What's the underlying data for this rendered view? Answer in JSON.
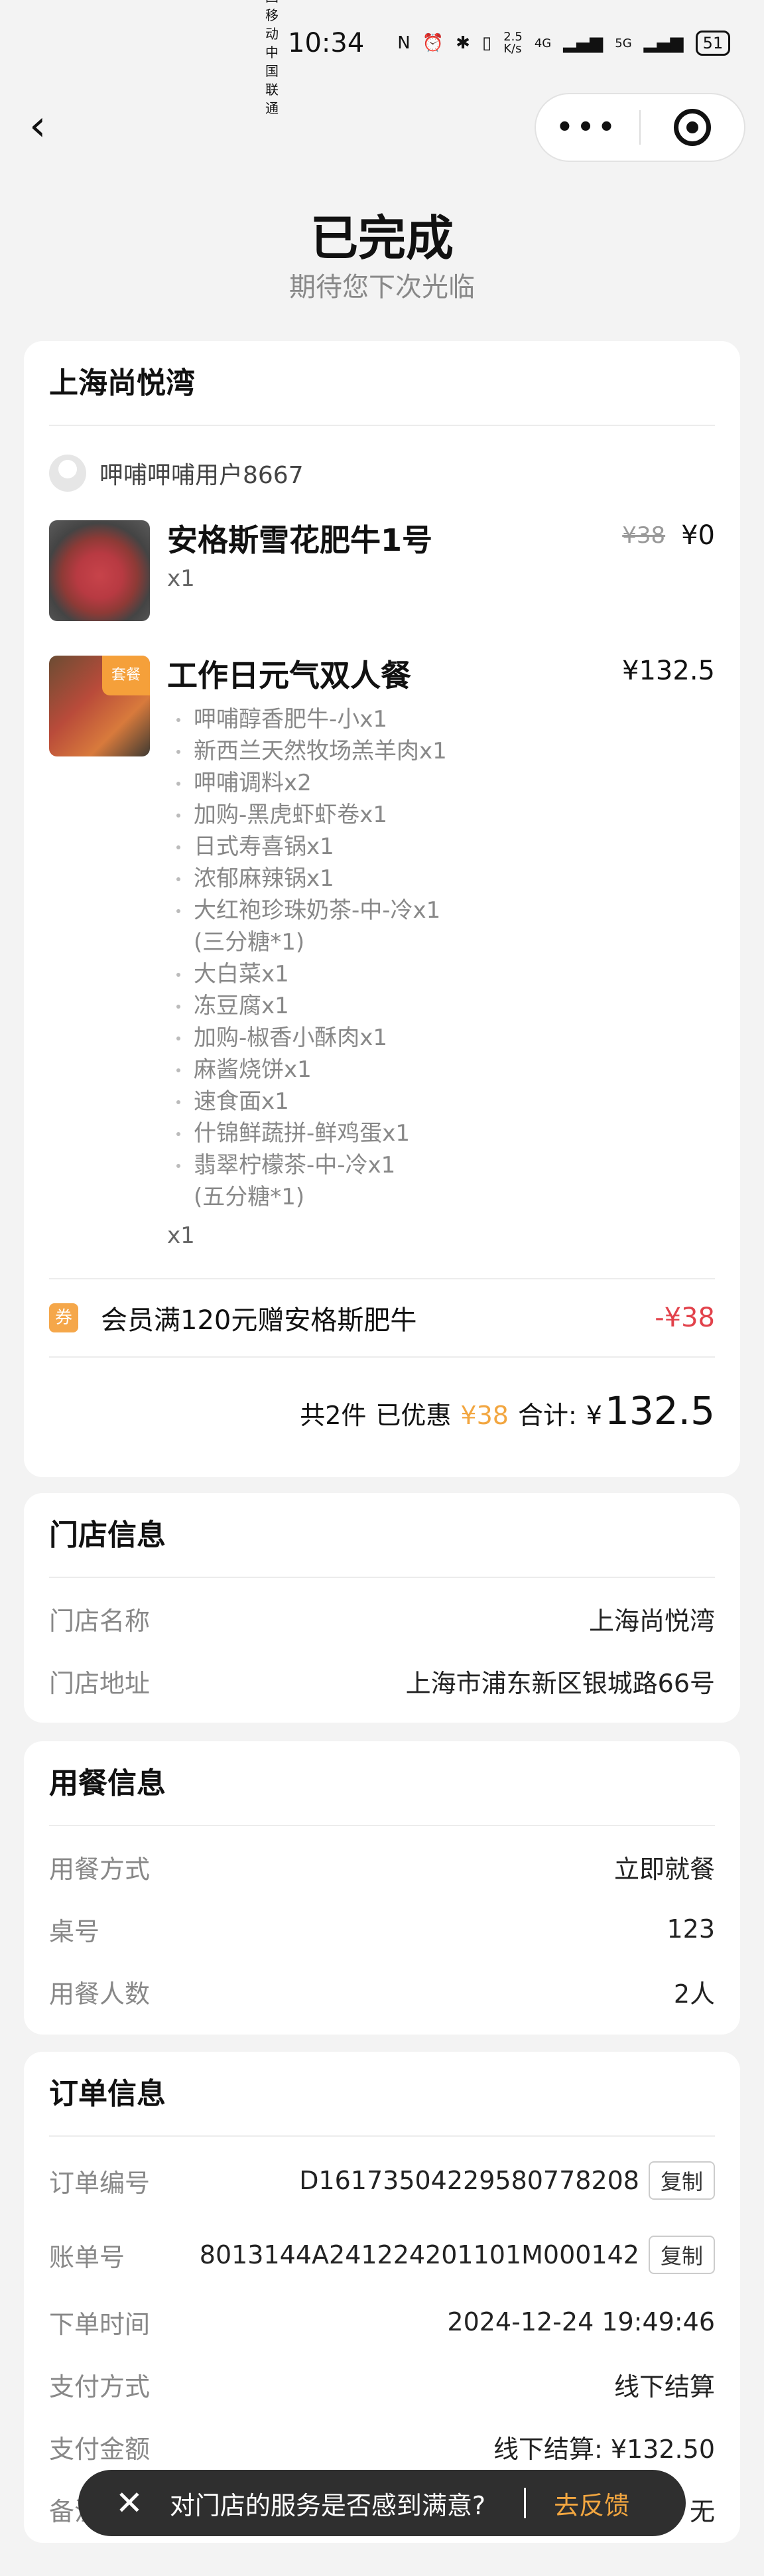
{
  "status_bar": {
    "carrier1": "中国移动",
    "carrier2": "中国联通",
    "time": "10:34",
    "icons": [
      "nfc-icon",
      "alarm-icon",
      "bluetooth-icon",
      "vibrate-icon",
      "speed",
      "signal-4g",
      "signal-5g"
    ],
    "speed": "2.5 K/s",
    "net1": "4G",
    "net2": "5G",
    "battery": "51"
  },
  "nav": {
    "back_glyph": "‹",
    "more_glyph": "•••"
  },
  "header": {
    "title": "已完成",
    "subtitle": "期待您下次光临"
  },
  "order": {
    "store": "上海尚悦湾",
    "user": "呷哺呷哺用户8667",
    "items": [
      {
        "name": "安格斯雪花肥牛1号",
        "qty": "x1",
        "orig_price": "¥38",
        "price": "¥0"
      },
      {
        "name": "工作日元气双人餐",
        "tag": "套餐",
        "price": "¥132.5",
        "sub": [
          "呷哺醇香肥牛-小x1",
          "新西兰天然牧场羔羊肉x1",
          "呷哺调料x2",
          "加购-黑虎虾虾卷x1",
          "日式寿喜锅x1",
          "浓郁麻辣锅x1",
          "大红袍珍珠奶茶-中-冷x1",
          "大白菜x1",
          "冻豆腐x1",
          "加购-椒香小酥肉x1",
          "麻酱烧饼x1",
          "速食面x1",
          "什锦鲜蔬拼-鲜鸡蛋x1",
          "翡翠柠檬茶-中-冷x1"
        ],
        "sub_note_6": "(三分糖*1)",
        "sub_note_13": "(五分糖*1)",
        "qty": "x1"
      }
    ],
    "promo": {
      "badge": "券",
      "text": "会员满120元赠安格斯肥牛",
      "amount": "-¥38"
    },
    "summary": {
      "count": "共2件",
      "discount_label": "已优惠",
      "discount": "¥38",
      "total_label": "合计:",
      "currency": "¥",
      "total": "132.5"
    }
  },
  "store_info": {
    "title": "门店信息",
    "name_label": "门店名称",
    "name": "上海尚悦湾",
    "addr_label": "门店地址",
    "addr": "上海市浦东新区银城路66号"
  },
  "dining_info": {
    "title": "用餐信息",
    "mode_label": "用餐方式",
    "mode": "立即就餐",
    "table_label": "桌号",
    "table": "123",
    "people_label": "用餐人数",
    "people": "2人"
  },
  "order_info": {
    "title": "订单信息",
    "no_label": "订单编号",
    "no": "D16173504229580778208",
    "bill_label": "账单号",
    "bill": "8013144A241224201101M000142",
    "copy": "复制",
    "time_label": "下单时间",
    "time": "2024-12-24 19:49:46",
    "pay_label": "支付方式",
    "pay": "线下结算",
    "amount_label": "支付金额",
    "amount": "线下结算: ¥132.50",
    "remark_label": "备注信息",
    "remark": "无"
  },
  "toast": {
    "close_glyph": "✕",
    "text": "对门店的服务是否感到满意?",
    "action": "去反馈"
  }
}
